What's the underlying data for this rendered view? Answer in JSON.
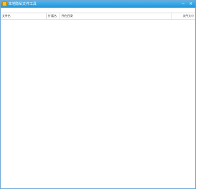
{
  "window": {
    "title": "本地隐私文件工具",
    "minimize_glyph": "−",
    "close_glyph": "×",
    "accent_color": "#1f93d8"
  },
  "icons": {
    "app": "app-icon",
    "minimize": "minimize-icon",
    "close": "close-icon"
  },
  "table": {
    "columns": [
      "文件名",
      "扩展名",
      "所在目录",
      "文件大小"
    ],
    "rows": []
  }
}
